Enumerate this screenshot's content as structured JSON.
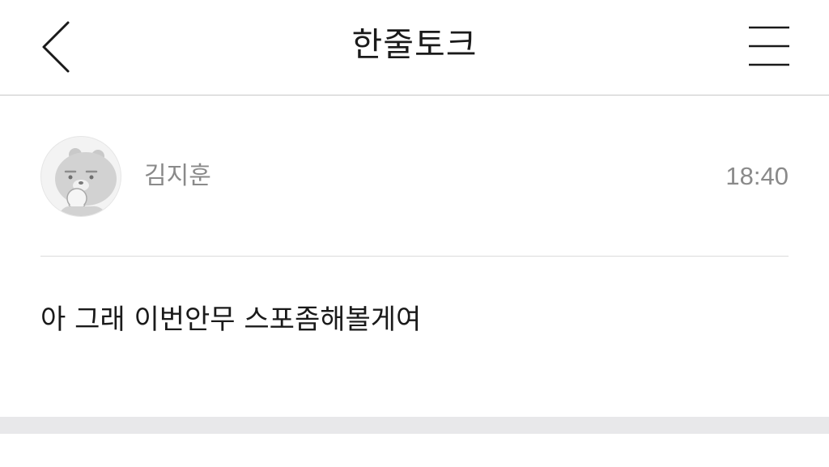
{
  "header": {
    "title": "한줄토크"
  },
  "post": {
    "author": "김지훈",
    "time": "18:40",
    "message": "아 그래 이번안무 스포좀해볼게여"
  },
  "icons": {
    "back": "chevron-left-icon",
    "menu": "hamburger-menu-icon",
    "avatar": "bear-character-avatar"
  }
}
